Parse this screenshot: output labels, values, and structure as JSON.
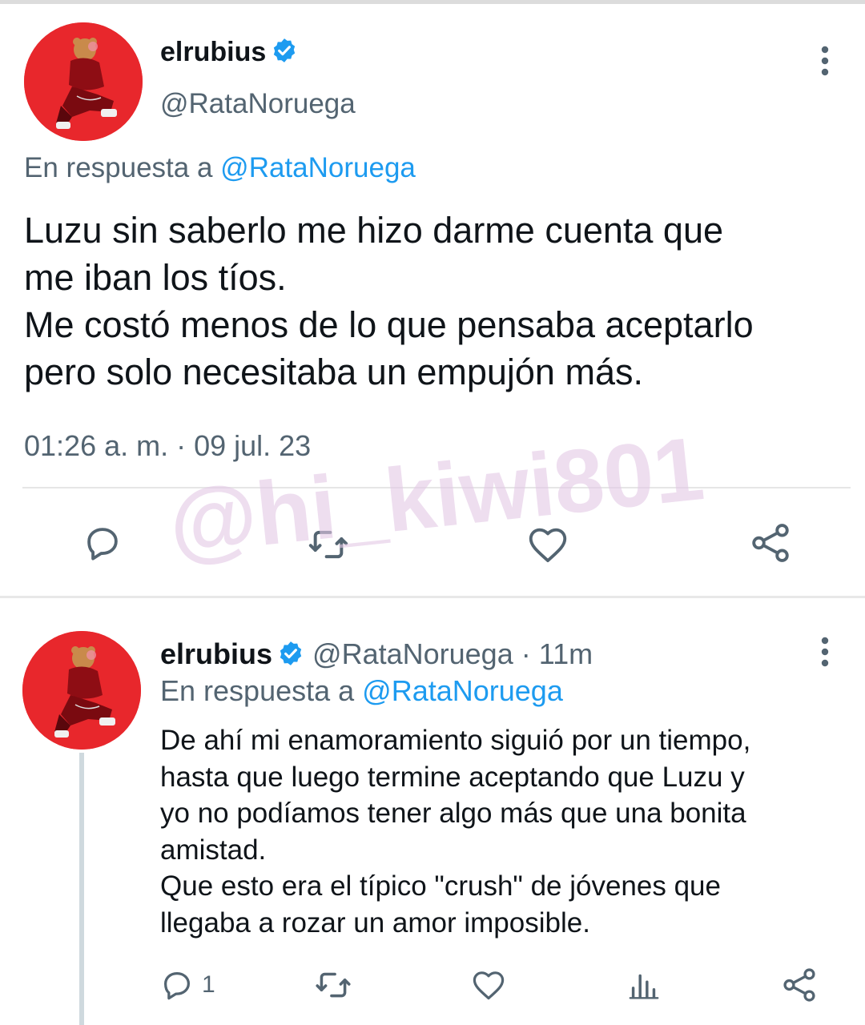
{
  "main_tweet": {
    "name": "elrubius",
    "handle": "@RataNoruega",
    "reply_prefix": "En respuesta a",
    "reply_mention": "@RataNoruega",
    "text_lines": [
      "Luzu sin saberlo me hizo darme cuenta que",
      "me iban los tíos.",
      "Me costó menos de lo que pensaba aceptarlo",
      "pero solo necesitaba un empujón más."
    ],
    "timestamp": "01:26 a. m. · 09 jul. 23",
    "actions": [
      "reply-icon",
      "retweet-icon",
      "like-icon",
      "share-icon"
    ]
  },
  "watermark": "@hi_kiwi801",
  "reply_tweet": {
    "name": "elrubius",
    "meta": "@RataNoruega · 11m",
    "reply_prefix": "En respuesta a",
    "reply_mention": "@RataNoruega",
    "text_lines": [
      "De ahí mi enamoramiento siguió por un tiempo,",
      "hasta que luego termine aceptando que Luzu y",
      "yo no podíamos tener algo más que una bonita",
      "amistad.",
      "Que esto era el típico \"crush\" de jóvenes que",
      "llegaba a rozar un amor imposible."
    ],
    "reply_count": "1",
    "actions": [
      "reply-icon",
      "retweet-icon",
      "like-icon",
      "analytics-icon",
      "share-icon"
    ]
  },
  "colors": {
    "avatar_bg": "#e8272c",
    "verified": "#1d9bf0",
    "link": "#1d9bf0",
    "secondary_text": "#536471",
    "watermark": "#e3c9e6"
  }
}
